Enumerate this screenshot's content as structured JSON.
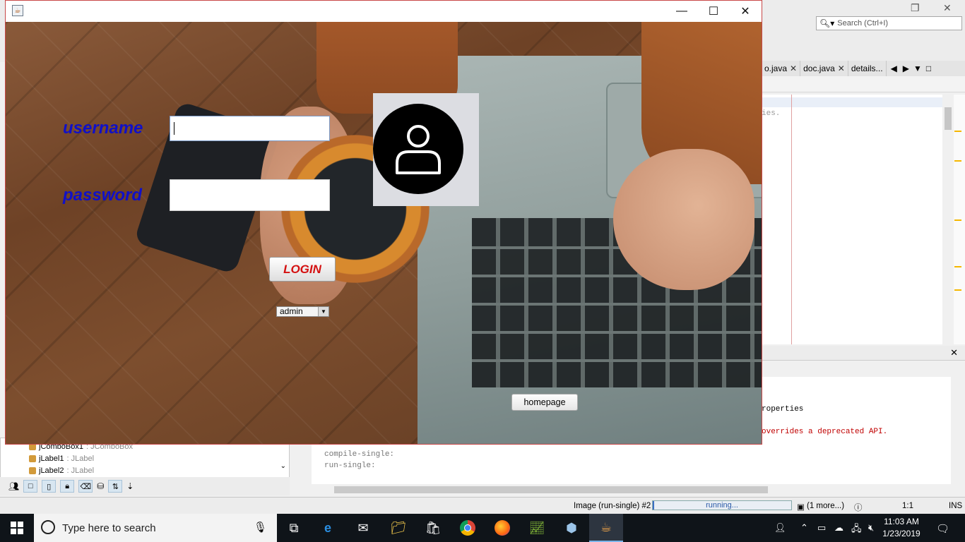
{
  "ide": {
    "search_placeholder": "Search (Ctrl+I)",
    "tabs": [
      {
        "label": "o.java"
      },
      {
        "label": "doc.java"
      },
      {
        "label": "details..."
      }
    ],
    "code_fragment": "ies.",
    "output_lines": [
      "roperties",
      "overrides a deprecated API.",
      "compile-single:",
      "run-single:"
    ],
    "navigator_items": [
      {
        "name": "jComboBox1",
        "type": ": JComboBox"
      },
      {
        "name": "jLabel1",
        "type": ": JLabel"
      },
      {
        "name": "jLabel2",
        "type": ": JLabel"
      }
    ],
    "status": {
      "task": "Image (run-single) #2",
      "progress_label": "running...",
      "more": "(1 more...)",
      "position": "1:1",
      "mode": "INS"
    }
  },
  "app": {
    "username_label": "username",
    "password_label": "password",
    "username_value": "",
    "password_value": "",
    "login_label": "LOGIN",
    "role_selected": "admin",
    "homepage_label": "homepage"
  },
  "taskbar": {
    "search_placeholder": "Type here to search",
    "time": "11:03 AM",
    "date": "1/23/2019"
  }
}
